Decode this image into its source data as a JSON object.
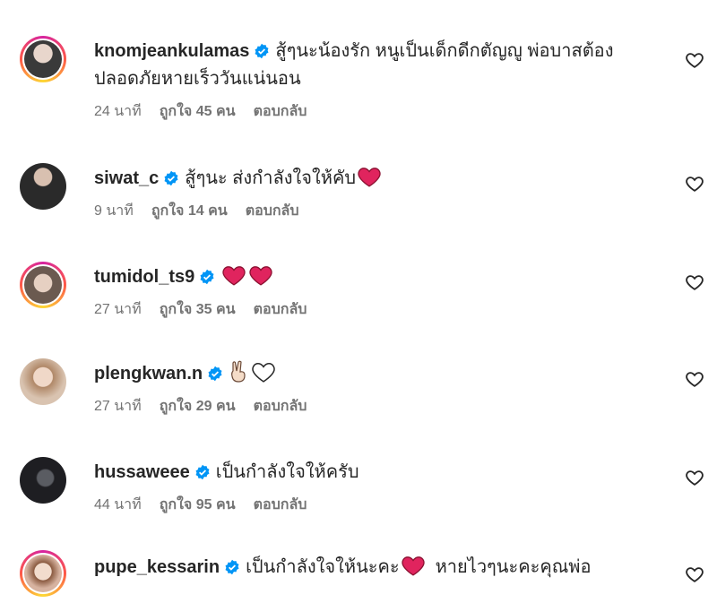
{
  "comments": [
    {
      "username": "knomjeankulamas",
      "text": "สู้ๆนะน้องรัก หนูเป็นเด็กดีกตัญญู พ่อบาสต้องปลอดภัยหายเร็ววันแน่นอน",
      "time": "24 นาที",
      "likes": "ถูกใจ 45 คน",
      "reply": "ตอบกลับ",
      "avatar_color": "#3a3a3a"
    },
    {
      "username": "siwat_c",
      "text": "สู้ๆนะ ส่งกำลังใจให้คับ",
      "time": "9 นาที",
      "likes": "ถูกใจ 14 คน",
      "reply": "ตอบกลับ",
      "avatar_color": "#2a2a2a"
    },
    {
      "username": "tumidol_ts9",
      "text": "",
      "time": "27 นาที",
      "likes": "ถูกใจ 35 คน",
      "reply": "ตอบกลับ",
      "avatar_color": "#8a7a70"
    },
    {
      "username": "plengkwan.n",
      "text": "",
      "time": "27 นาที",
      "likes": "ถูกใจ 29 คน",
      "reply": "ตอบกลับ",
      "avatar_color": "#c9a88a"
    },
    {
      "username": "hussaweee",
      "text": "เป็นกำลังใจให้ครับ",
      "time": "44 นาที",
      "likes": "ถูกใจ 95 คน",
      "reply": "ตอบกลับ",
      "avatar_color": "#1e1e22"
    },
    {
      "username": "pupe_kessarin",
      "text_part1": "เป็นกำลังใจให้นะคะ",
      "text_part2": "หายไวๆนะคะคุณพ่อ",
      "avatar_color": "#d7b3a0"
    }
  ],
  "colors": {
    "verified": "#0095f6",
    "heart_emoji": "#e0245e",
    "meta_text": "#737373"
  },
  "icons": {
    "like": "heart-outline-icon",
    "verified": "verified-badge-icon",
    "victory": "victory-hand-emoji",
    "white_heart": "white-heart-emoji"
  }
}
